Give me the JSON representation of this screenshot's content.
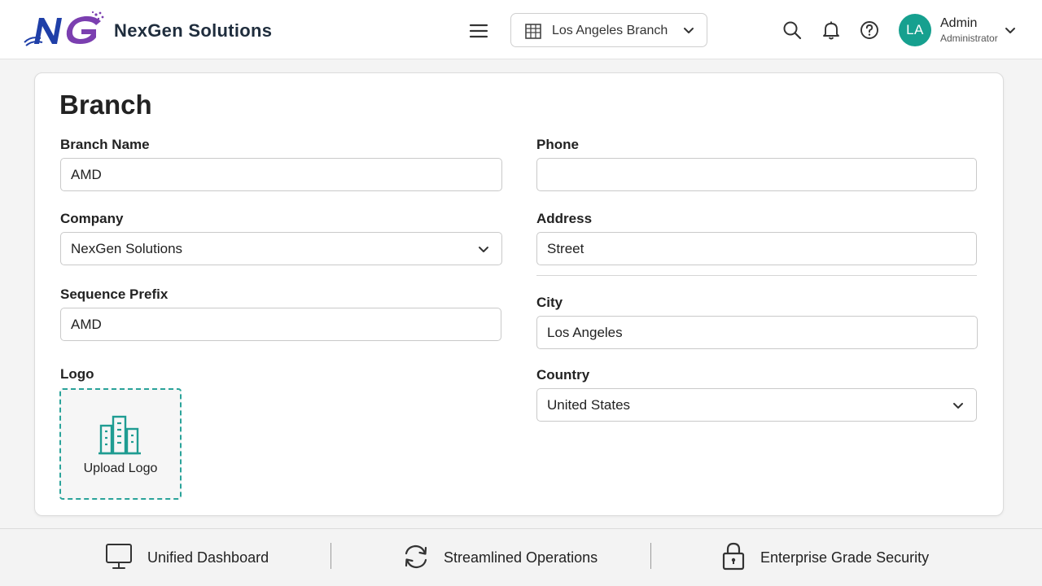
{
  "header": {
    "brand_name": "NexGen Solutions",
    "logo_text": "NG",
    "branch_selector": "Los Angeles Branch",
    "user": {
      "initials": "LA",
      "name": "Admin",
      "role": "Administrator"
    }
  },
  "form": {
    "title": "Branch",
    "branch_name": {
      "label": "Branch Name",
      "value": "AMD"
    },
    "company": {
      "label": "Company",
      "value": "NexGen Solutions"
    },
    "sequence_prefix": {
      "label": "Sequence Prefix",
      "value": "AMD"
    },
    "logo": {
      "label": "Logo",
      "upload_label": "Upload Logo"
    },
    "phone": {
      "label": "Phone",
      "value": ""
    },
    "address": {
      "label": "Address",
      "value": "Street"
    },
    "city": {
      "label": "City",
      "value": "Los Angeles"
    },
    "country": {
      "label": "Country",
      "value": "United States"
    }
  },
  "features": [
    {
      "label": "Unified Dashboard",
      "icon": "monitor-icon"
    },
    {
      "label": "Streamlined Operations",
      "icon": "refresh-icon"
    },
    {
      "label": "Enterprise Grade Security",
      "icon": "lock-icon"
    }
  ],
  "colors": {
    "accent": "#16a08f",
    "logo_blue": "#1f3fa8",
    "logo_purple": "#7b3fb0"
  }
}
